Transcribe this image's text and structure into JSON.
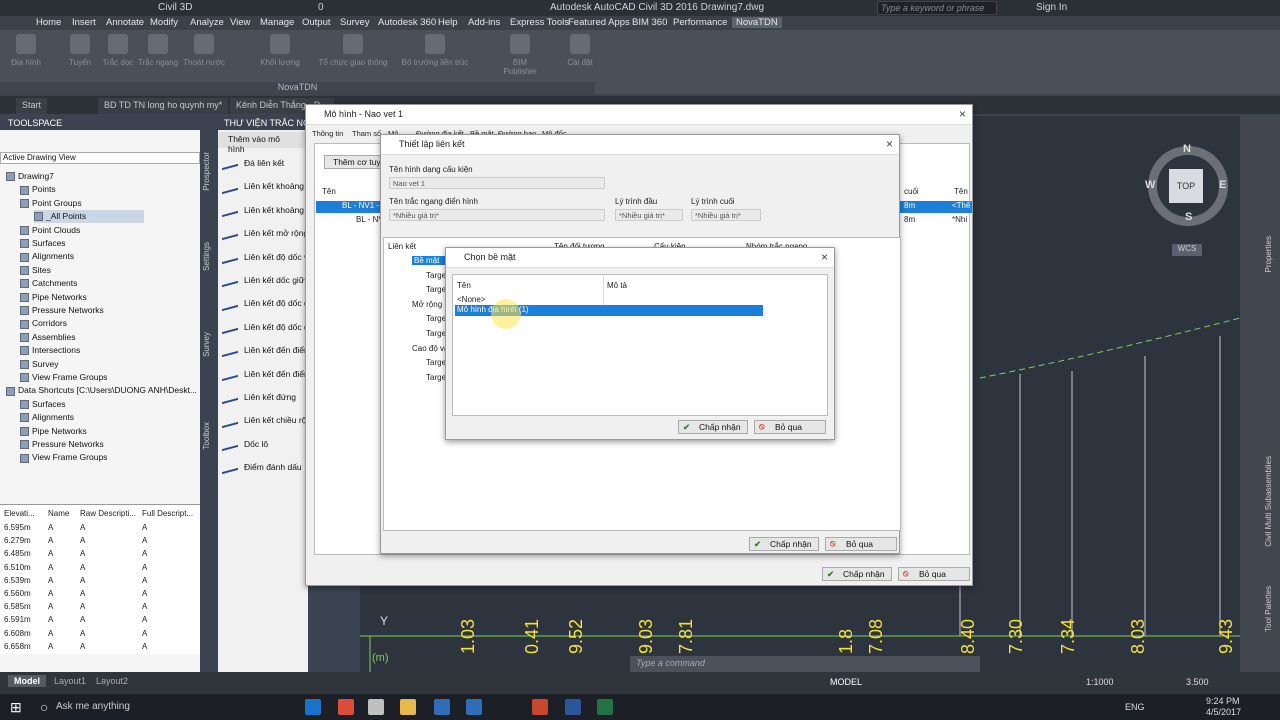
{
  "titlebar": {
    "workspace": "Civil 3D",
    "layer": "0",
    "title": "Autodesk AutoCAD Civil 3D 2016   Drawing7.dwg",
    "search_placeholder": "Type a keyword or phrase",
    "signin": "Sign In"
  },
  "menu": [
    "Home",
    "Insert",
    "Annotate",
    "Modify",
    "Analyze",
    "View",
    "Manage",
    "Output",
    "Survey",
    "Autodesk 360",
    "Help",
    "Add-ins",
    "Express Tools",
    "Featured Apps",
    "BIM 360",
    "Performance",
    "NovaTDN"
  ],
  "ribbon": {
    "buttons": [
      "Địa hình",
      "Tuyến",
      "Trắc dọc",
      "Trắc ngang",
      "Thoát nước",
      "Khối lượng",
      "Tổ chức giao thông",
      "Bố trường liên trúc",
      "BIM Publisher",
      "Cài đặt"
    ],
    "panel_label": "NovaTDN"
  },
  "doctabs": [
    "Start",
    "BD TD TN long ho quynh my*",
    "Kênh Diễn Thắng - Đ..."
  ],
  "toolspace": {
    "title": "TOOLSPACE",
    "view": "Active Drawing View",
    "tree": [
      "Drawing7",
      "Points",
      "Point Groups",
      "_All Points",
      "Point Clouds",
      "Surfaces",
      "Alignments",
      "Sites",
      "Catchments",
      "Pipe Networks",
      "Pressure Networks",
      "Corridors",
      "Assemblies",
      "Intersections",
      "Survey",
      "View Frame Groups",
      "Data Shortcuts [C:\\Users\\DUONG ANH\\Deskt...",
      "Surfaces",
      "Alignments",
      "Pipe Networks",
      "Pressure Networks",
      "View Frame Groups"
    ],
    "table_headers": [
      "Elevati...",
      "Name",
      "Raw Descripti...",
      "Full Descript..."
    ],
    "table_rows": [
      [
        "6.595m",
        "A",
        "A",
        "A"
      ],
      [
        "6.279m",
        "A",
        "A",
        "A"
      ],
      [
        "6.485m",
        "A",
        "A",
        "A"
      ],
      [
        "6.510m",
        "A",
        "A",
        "A"
      ],
      [
        "6.539m",
        "A",
        "A",
        "A"
      ],
      [
        "6.560m",
        "A",
        "A",
        "A"
      ],
      [
        "6.585m",
        "A",
        "A",
        "A"
      ],
      [
        "6.591m",
        "A",
        "A",
        "A"
      ],
      [
        "6.608m",
        "A",
        "A",
        "A"
      ],
      [
        "6.658m",
        "A",
        "A",
        "A"
      ]
    ]
  },
  "side_tabs": [
    "Prospector",
    "Settings",
    "Survey",
    "Toolbox"
  ],
  "palette": {
    "title": "THƯ VIỆN TRẮC NGANG",
    "tab": "Thêm vào mô hình",
    "items": [
      "Đá liên kết",
      "Liên kết khoảng c",
      "Liên kết khoảng c",
      "Liên kết mở rộng t",
      "Liên kết độ dốc và",
      "Liên kết dốc giữa",
      "Liên kết độ dốc đ",
      "Liên kết độ dốc đ",
      "Liên kết đến điểm",
      "Liên kết đến điểm",
      "Liên kết đứng",
      "Liên kết chiều rộn",
      "Dốc lô",
      "Điểm đánh dấu"
    ]
  },
  "dialog_main": {
    "title": "Mô hình - Nao vet 1",
    "tabs": [
      "Thông tin",
      "Tham số",
      "Mô...",
      "Đường địa kết",
      "Bề mặt",
      "Đường bao",
      "Mô đốc"
    ],
    "add_button": "Thêm cơ tuyế...",
    "col_name": "Tên",
    "col_end": "cuối",
    "col_ten": "Tên",
    "rows": [
      [
        "BL - NV1 -",
        "8m",
        "<Thế"
      ],
      [
        "BL - NV",
        "8m",
        "*Nhi"
      ]
    ],
    "ok": "Chấp nhận",
    "cancel": "Bỏ qua"
  },
  "dialog_link": {
    "title": "Thiết lập liên kết",
    "label_template": "Tên hình dạng cấu kiện",
    "value_template": "Nao vet 1",
    "label_section": "Tên trắc ngang điển hình",
    "value_section": "*Nhiều giá trị*",
    "label_start": "Lý trình đầu",
    "value_start": "*Nhiều giá trị*",
    "label_end": "Lý trình cuối",
    "value_end": "*Nhiều giá trị*",
    "grid_headers": [
      "Liên kết",
      "Tên đối tượng",
      "Cấu kiện",
      "Nhóm trắc ngang"
    ],
    "grid_rows": [
      "Bề mặt",
      "Target",
      "Target",
      "Mở rộng",
      "Target",
      "Target",
      "Cao độ và...",
      "Target",
      "Target"
    ],
    "ok": "Chấp nhận",
    "cancel": "Bỏ qua"
  },
  "dialog_surface": {
    "title": "Chọn bề mặt",
    "col_name": "Tên",
    "col_desc": "Mô tả",
    "rows": [
      "<None>",
      "Mô hình địa hình (1)"
    ],
    "ok": "Chấp nhận",
    "cancel": "Bỏ qua"
  },
  "drawing": {
    "compass": {
      "n": "N",
      "s": "S",
      "e": "E",
      "w": "W",
      "top": "TOP",
      "wcs": "WCS"
    },
    "axis_labels": [
      "1.03",
      "0.41",
      "9.52",
      "9.03",
      "7.81",
      "1.8",
      "7.08",
      "8.40",
      "7.30",
      "7.34",
      "8.03",
      "9.43"
    ],
    "ucs_y": "Y",
    "ucs_m": "(m)"
  },
  "right_tabs": [
    "Properties",
    "Civil Multi Subassemblies",
    "Tool Palettes"
  ],
  "command_placeholder": "Type a command",
  "status": {
    "tabs": [
      "Model",
      "Layout1",
      "Layout2"
    ],
    "model_label": "MODEL",
    "scale": "1:1000",
    "number": "3.500"
  },
  "taskbar": {
    "search": "Ask me anything",
    "lang": "ENG",
    "time": "9:24 PM",
    "date": "4/5/2017"
  }
}
